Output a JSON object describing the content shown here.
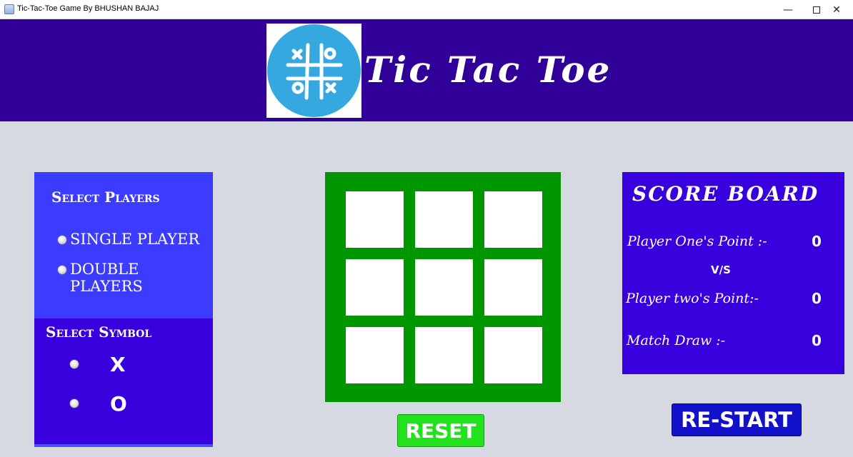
{
  "window": {
    "title": "Tic-Tac-Toe Game By BHUSHAN BAJAJ",
    "minimize_glyph": "—",
    "close_glyph": "✕"
  },
  "header": {
    "title": "Tic Tac Toe",
    "logo_icon": "tic-tac-toe-logo-icon"
  },
  "players_panel": {
    "heading": "Select Players",
    "options": [
      "SINGLE PLAYER",
      "DOUBLE PLAYERS"
    ]
  },
  "symbol_panel": {
    "heading": "Select Symbol",
    "options": [
      "X",
      "O"
    ]
  },
  "board": {
    "cells": [
      "",
      "",
      "",
      "",
      "",
      "",
      "",
      "",
      ""
    ]
  },
  "reset_label": "RESET",
  "score_board": {
    "title": "SCORE BOARD",
    "player_one_label": "Player One's Point :-",
    "player_one_value": "0",
    "vs": "V/S",
    "player_two_label": "Player two's Point:-",
    "player_two_value": "0",
    "draw_label": "Match Draw :-",
    "draw_value": "0"
  },
  "restart_label": "RE-START",
  "colors": {
    "header": "#310099",
    "panel_light": "#3b3cff",
    "panel_dark": "#3700dc",
    "board": "#009600",
    "reset": "#21e21d",
    "restart": "#1310c9"
  }
}
